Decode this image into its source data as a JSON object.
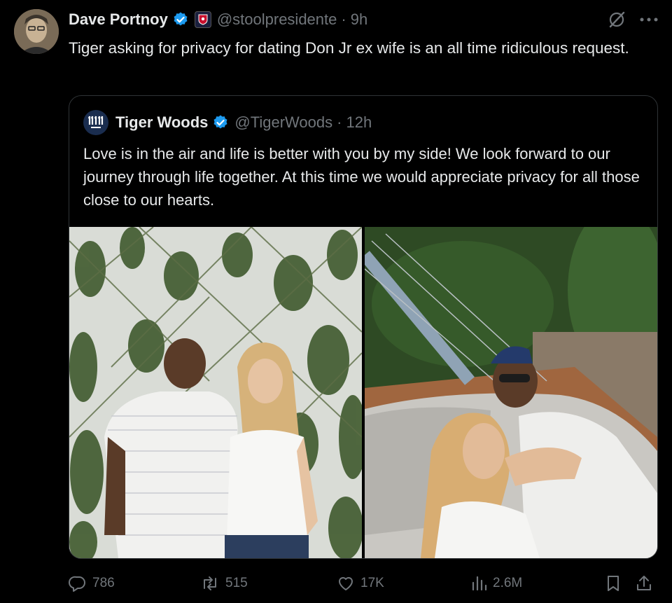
{
  "post": {
    "author_name": "Dave Portnoy",
    "handle": "@stoolpresidente",
    "separator": "·",
    "time": "9h",
    "text": "Tiger asking for privacy for dating Don Jr ex wife is an all time ridiculous request."
  },
  "quoted": {
    "author_name": "Tiger Woods",
    "handle": "@TigerWoods",
    "separator": "·",
    "time": "12h",
    "text": "Love is in the air and life is better with you by my side! We look forward to our journey through life together. At this time we would appreciate privacy for all those close to our hearts."
  },
  "actions": {
    "replies": "786",
    "reposts": "515",
    "likes": "17K",
    "views": "2.6M"
  },
  "icons": [
    "verified-icon",
    "affiliate-badge-icon",
    "grok-icon",
    "more-icon",
    "reply-icon",
    "repost-icon",
    "like-icon",
    "views-icon",
    "bookmark-icon",
    "share-icon"
  ],
  "colors": {
    "verified": "#1d9bf0",
    "muted": "#71767b",
    "text": "#e7e9ea",
    "background": "#000000"
  }
}
